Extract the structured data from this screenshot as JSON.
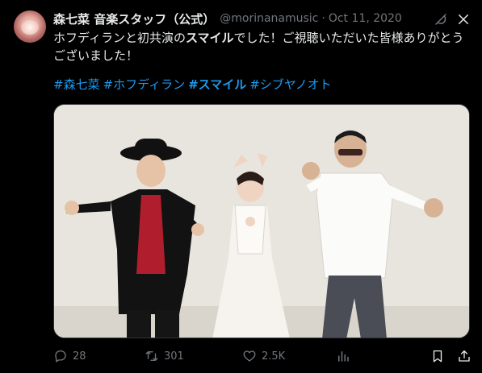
{
  "tweet": {
    "display_name": "森七菜 音楽スタッフ（公式）",
    "handle": "@morinanamusic",
    "separator": "·",
    "date": "Oct 11, 2020",
    "text_part1": "ホフディランと初共演の",
    "text_bold": "スマイル",
    "text_part2": "でした！ご視聴いただいた皆様ありがとうございました！",
    "hashtags": [
      "#森七菜",
      "#ホフディラン",
      "#スマイル",
      "#シブヤノオト"
    ],
    "media_alt": "写真"
  },
  "actions": {
    "replies": "28",
    "reposts": "301",
    "likes": "2.5K"
  },
  "icons": {
    "avatar": "avatar",
    "grok": "grok-icon",
    "close": "close-icon",
    "reply": "reply-icon",
    "repost": "repost-icon",
    "like": "heart-icon",
    "views": "views-icon",
    "bookmark": "bookmark-icon",
    "share": "share-icon"
  },
  "colors": {
    "background": "#000000",
    "text": "#e7e9ea",
    "secondary": "#71767b",
    "link": "#1d9bf0"
  }
}
